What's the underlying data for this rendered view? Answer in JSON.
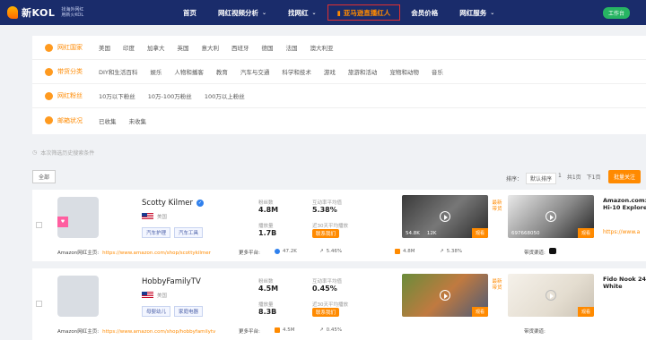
{
  "header": {
    "logo_text": "新KOL",
    "logo_sub1": "找海外网红",
    "logo_sub2": "用新火KOL",
    "nav": [
      {
        "label": "首页"
      },
      {
        "label": "网红视频分析",
        "chevron": true
      },
      {
        "label": "找网红",
        "chevron": true
      },
      {
        "label": "亚马逊直播红人",
        "highlight": true
      },
      {
        "label": "会员价格"
      },
      {
        "label": "网红服务",
        "chevron": true
      }
    ],
    "workbench": "工作台"
  },
  "filters": [
    {
      "category": "网红国家",
      "options": [
        "美国",
        "印度",
        "加拿大",
        "英国",
        "意大利",
        "西班牙",
        "德国",
        "法国",
        "澳大利亚"
      ]
    },
    {
      "category": "带货分类",
      "options": [
        "DIY和生活百科",
        "娱乐",
        "人物和播客",
        "教育",
        "汽车与交通",
        "科学和技术",
        "游戏",
        "旅游和活动",
        "宠物和动物",
        "音乐"
      ]
    },
    {
      "category": "网红粉丝",
      "options": [
        "10万以下粉丝",
        "10万-100万粉丝",
        "100万以上粉丝"
      ]
    },
    {
      "category": "邮箱状况",
      "options": [
        "已收集",
        "未收集"
      ]
    }
  ],
  "saved_conditions": "本次筛选历史搜索条件",
  "toolbar": {
    "all_label": "全部",
    "sort_label": "排序：",
    "sort_value": "默认排序",
    "pager": [
      "1",
      "共1页",
      "下1页"
    ],
    "batch_button": "批量关注"
  },
  "cards": [
    {
      "name": "Scotty Kilmer",
      "country": "美国",
      "tags": [
        "汽车护理",
        "汽车工具"
      ],
      "verified": true,
      "stats": [
        {
          "label": "粉丝数",
          "value": "4.8M"
        },
        {
          "label": "播放量",
          "value": "1.7B"
        },
        {
          "label": "互动率平均值",
          "value": "5.38%"
        },
        {
          "label": "近30天平均播放",
          "value": ""
        }
      ],
      "contact_label": "联系我们",
      "thumb1": {
        "likes": "54.8K",
        "views": "12K",
        "button": "观看"
      },
      "latest_label": "最新带货",
      "thumb2": {
        "views": "697668050",
        "button": "观看"
      },
      "product_title": "Amazon.com:\nHi-10 Explore",
      "product_link": "https://www.a",
      "amazon_label": "Amazon网红主页:",
      "amazon_url": "https://www.amazon.com/shop/scottykilmer",
      "more_label": "更多平台:",
      "mini": [
        {
          "value": "47.2K",
          "color": "#2f80ed"
        },
        {
          "value": "5.46%",
          "color": "#ff8a00"
        },
        {
          "value": "4.8M",
          "color": "#ff8a00"
        },
        {
          "value": "5.38%",
          "color": "#ff8a00"
        }
      ],
      "channel_label": "带货渠道:"
    },
    {
      "name": "HobbyFamilyTV",
      "country": "美国",
      "tags": [
        "母婴幼儿",
        "家庭电器"
      ],
      "verified": false,
      "stats": [
        {
          "label": "粉丝数",
          "value": "4.5M"
        },
        {
          "label": "播放量",
          "value": "8.3B"
        },
        {
          "label": "互动率平均值",
          "value": "0.45%"
        },
        {
          "label": "近30天平均播放",
          "value": ""
        }
      ],
      "contact_label": "联系我们",
      "thumb1": {
        "button": "观看"
      },
      "latest_label": "最新带货",
      "thumb2": {
        "button": "观看"
      },
      "product_title": "Fido Nook 24\nWhite",
      "product_link": "",
      "amazon_label": "Amazon网红主页:",
      "amazon_url": "https://www.amazon.com/shop/hobbyfamilytv",
      "more_label": "更多平台:",
      "mini": [
        {
          "value": "4.5M",
          "color": "#ff8a00"
        },
        {
          "value": "0.45%",
          "color": "#ff8a00"
        }
      ],
      "channel_label": "带货渠道:"
    }
  ]
}
